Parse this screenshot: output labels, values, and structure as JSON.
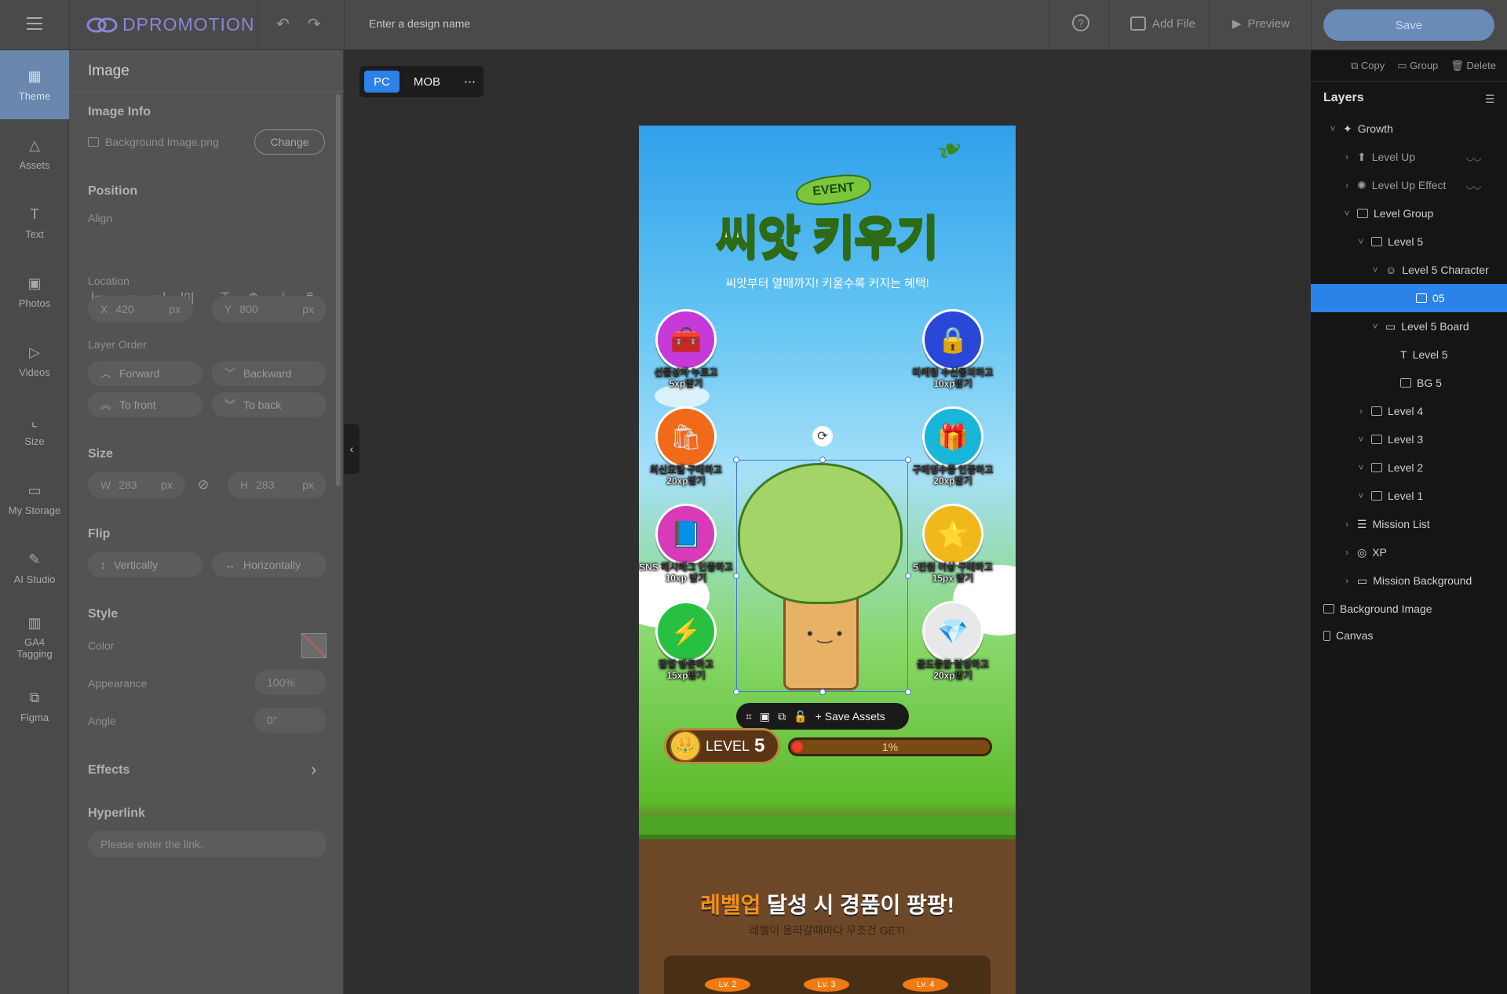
{
  "app": {
    "logo_text": "DPROMOTION",
    "design_name_placeholder": "Enter a design name",
    "add_file": "Add File",
    "preview": "Preview",
    "save": "Save"
  },
  "nav": [
    {
      "label": "Theme",
      "icon": "theme-icon"
    },
    {
      "label": "Assets",
      "icon": "assets-icon"
    },
    {
      "label": "Text",
      "icon": "text-icon"
    },
    {
      "label": "Photos",
      "icon": "photos-icon"
    },
    {
      "label": "Videos",
      "icon": "videos-icon"
    },
    {
      "label": "Size",
      "icon": "size-icon"
    },
    {
      "label": "My Storage",
      "icon": "folder-icon"
    },
    {
      "label": "AI Studio",
      "icon": "magic-wand-icon"
    },
    {
      "label": "GA4 Tagging",
      "icon": "bar-chart-icon"
    },
    {
      "label": "Figma",
      "icon": "figma-icon"
    }
  ],
  "panel": {
    "title": "Image",
    "image_info": {
      "heading": "Image Info",
      "file_name": "Background Image.png",
      "change": "Change"
    },
    "position": {
      "heading": "Position",
      "align_label": "Align",
      "location_label": "Location",
      "x_label": "X",
      "x_value": "420",
      "x_unit": "px",
      "y_label": "Y",
      "y_value": "800",
      "y_unit": "px",
      "layer_order_label": "Layer Order",
      "forward": "Forward",
      "backward": "Backward",
      "to_front": "To front",
      "to_back": "To back"
    },
    "size": {
      "heading": "Size",
      "w_label": "W",
      "w_value": "283",
      "w_unit": "px",
      "h_label": "H",
      "h_value": "283",
      "h_unit": "px"
    },
    "flip": {
      "heading": "Flip",
      "vertically": "Vertically",
      "horizontally": "Horizontally"
    },
    "style": {
      "heading": "Style",
      "color_label": "Color",
      "appearance_label": "Appearance",
      "appearance_value": "100%",
      "angle_label": "Angle",
      "angle_value": "0°"
    },
    "effects": "Effects",
    "hyperlink": {
      "heading": "Hyperlink",
      "placeholder": "Please enter the link."
    }
  },
  "device": {
    "pc": "PC",
    "mob": "MOB"
  },
  "design": {
    "event_tag": "EVENT",
    "title": "씨앗 키우기",
    "subtitle": "씨앗부터 열매까지! 키울수록 커지는 혜택!",
    "missions": [
      {
        "label_1": "선물상자 누르고",
        "label_2": "5xp받기",
        "color": "#c53ad8",
        "icon": "🧰"
      },
      {
        "label_1": "마케팅 수신동의하고",
        "label_2": "10xp받기",
        "color": "#2a48d8",
        "icon": "🔒"
      },
      {
        "label_1": "최신모델 구매하고",
        "label_2": "20xp받기",
        "color": "#f06a1a",
        "icon": "🛍"
      },
      {
        "label_1": "구매영수증 인증하고",
        "label_2": "20xp받기",
        "color": "#18b6d8",
        "icon": "🎁"
      },
      {
        "label_1": "SNS 해시태그 인증하고",
        "label_2": "10xp 받기",
        "color": "#d83ab8",
        "icon": "📘"
      },
      {
        "label_1": "5만원 이상 구매하고",
        "label_2": "15px 받기",
        "color": "#f0b81a",
        "icon": "⭐"
      },
      {
        "label_1": "팝업 방문하고",
        "label_2": "15xp받기",
        "color": "#28c040",
        "icon": "⚡"
      },
      {
        "label_1": "골드등급 달성하고",
        "label_2": "20xp받기",
        "color": "#e8e8e8",
        "icon": "💎"
      }
    ],
    "save_assets": "Save Assets",
    "level_label": "LEVEL",
    "level_num": "5",
    "xp_percent": "1%",
    "reward_title_hl": "레벨업",
    "reward_title_rest": " 달성 시 경품이 팡팡!",
    "reward_sub": "레벨이 올라갈때마다 무조건 GET!",
    "level_pills": [
      "Lv. 2",
      "Lv. 3",
      "Lv. 4"
    ]
  },
  "layers_panel": {
    "copy": "Copy",
    "group": "Group",
    "delete": "Delete",
    "title": "Layers",
    "items": [
      {
        "name": "Growth",
        "chev": "˅"
      },
      {
        "name": "Level Up",
        "chev": "›"
      },
      {
        "name": "Level Up Effect",
        "chev": "›"
      },
      {
        "name": "Level Group",
        "chev": "˅"
      },
      {
        "name": "Level 5",
        "chev": "˅"
      },
      {
        "name": "Level 5 Character",
        "chev": "˅"
      },
      {
        "name": "05",
        "chev": ""
      },
      {
        "name": "Level 5 Board",
        "chev": "˅"
      },
      {
        "name": "Level 5",
        "chev": ""
      },
      {
        "name": "BG 5",
        "chev": ""
      },
      {
        "name": "Level 4",
        "chev": "›"
      },
      {
        "name": "Level 3",
        "chev": "˅"
      },
      {
        "name": "Level 2",
        "chev": "˅"
      },
      {
        "name": "Level 1",
        "chev": "˅"
      },
      {
        "name": "Mission List",
        "chev": "›"
      },
      {
        "name": "XP",
        "chev": "›"
      },
      {
        "name": "Mission Background",
        "chev": "›"
      },
      {
        "name": "Background Image",
        "chev": ""
      },
      {
        "name": "Canvas",
        "chev": ""
      }
    ]
  }
}
